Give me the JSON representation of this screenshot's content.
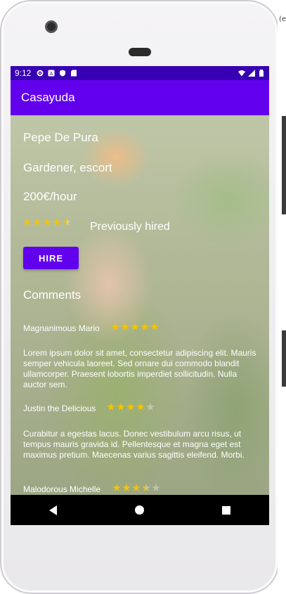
{
  "status_bar": {
    "time": "9:12",
    "left_icons": [
      "settings-icon",
      "a-icon",
      "shield-icon",
      "sd-card-icon"
    ],
    "right_icons": [
      "wifi-icon",
      "signal-icon",
      "battery-icon"
    ]
  },
  "edge_text": "(e",
  "app_bar": {
    "title": "Casayuda"
  },
  "profile": {
    "name": "Pepe    De Pura",
    "profession": "Gardener, escort",
    "rate": "200€/hour",
    "rating": 4.5,
    "previously_hired": "Previously hired",
    "hire_label": "HIRE"
  },
  "comments_title": "Comments",
  "comments": [
    {
      "author": "Magnanimous Mario",
      "rating": 5,
      "text": "Lorem ipsum dolor sit amet, consectetur adipiscing elit. Mauris semper vehicula laoreet. Sed ornare dui commodo blandit ullamcorper. Praesent lobortis imperdiet sollicitudin. Nulla auctor sem."
    },
    {
      "author": "Justin the Delicious",
      "rating": 4,
      "text": "Curabitur a egestas lacus. Donec vestibulum arcu risus, ut tempus mauris gravida id. Pellentesque et magna eget est maximus pretium. Maecenas varius sagittis eleifend. Morbi."
    },
    {
      "author": "Malodorous Michelle",
      "rating": 3.5,
      "text": ""
    }
  ],
  "nav_bar": [
    "back-icon",
    "home-icon",
    "recents-icon"
  ],
  "colors": {
    "status_bar": "#3700b3",
    "app_bar": "#6200ee",
    "button": "#6200ee",
    "star": "#f5c400"
  }
}
